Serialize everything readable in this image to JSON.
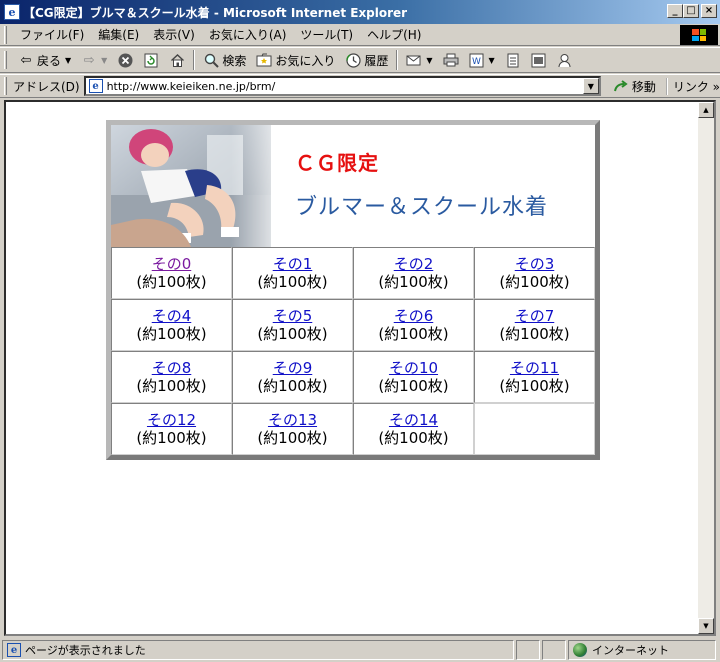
{
  "window": {
    "title": "【CG限定】ブルマ＆スクール水着 - Microsoft Internet Explorer",
    "app_icon": "e",
    "buttons": {
      "minimize": "_",
      "maximize": "□",
      "close": "×"
    }
  },
  "menu": {
    "items": [
      "ファイル(F)",
      "編集(E)",
      "表示(V)",
      "お気に入り(A)",
      "ツール(T)",
      "ヘルプ(H)"
    ]
  },
  "toolbar": {
    "back": "戻る",
    "search": "検索",
    "favorites": "お気に入り",
    "history": "履歴"
  },
  "address": {
    "label": "アドレス(D)",
    "url": "http://www.keieiken.ne.jp/brm/",
    "go": "移動",
    "links": "リンク »"
  },
  "banner": {
    "line1": "ＣＧ限定",
    "line2": "ブルマー＆スクール水着"
  },
  "gallery": {
    "items": [
      {
        "link": "その0",
        "count": "(約100枚)"
      },
      {
        "link": "その1",
        "count": "(約100枚)"
      },
      {
        "link": "その2",
        "count": "(約100枚)"
      },
      {
        "link": "その3",
        "count": "(約100枚)"
      },
      {
        "link": "その4",
        "count": "(約100枚)"
      },
      {
        "link": "その5",
        "count": "(約100枚)"
      },
      {
        "link": "その6",
        "count": "(約100枚)"
      },
      {
        "link": "その7",
        "count": "(約100枚)"
      },
      {
        "link": "その8",
        "count": "(約100枚)"
      },
      {
        "link": "その9",
        "count": "(約100枚)"
      },
      {
        "link": "その10",
        "count": "(約100枚)"
      },
      {
        "link": "その11",
        "count": "(約100枚)"
      },
      {
        "link": "その12",
        "count": "(約100枚)"
      },
      {
        "link": "その13",
        "count": "(約100枚)"
      },
      {
        "link": "その14",
        "count": "(約100枚)"
      }
    ]
  },
  "status": {
    "message": "ページが表示されました",
    "zone": "インターネット"
  },
  "colors": {
    "titlebar": "#0a246a",
    "link": "#1010c8",
    "visited_link": "#7a1aa0",
    "banner_red": "#e61010",
    "banner_blue": "#2a5aa0"
  }
}
